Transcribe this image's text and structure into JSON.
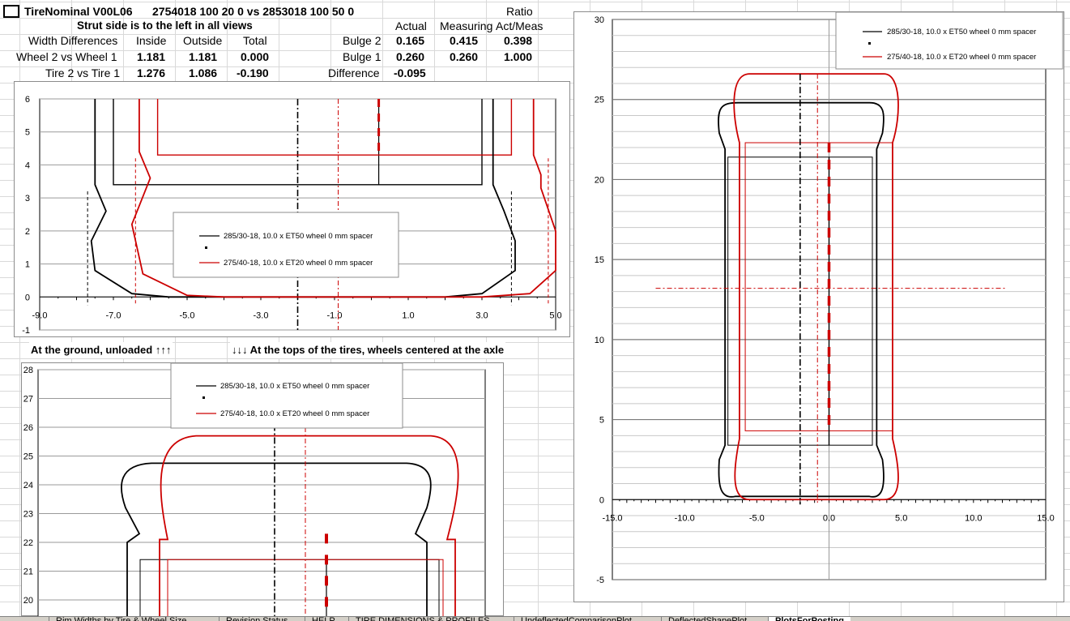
{
  "header": {
    "title": "TireNominal V00L06",
    "compare": "2754018 100 20 0 vs  2853018 100 50 0",
    "ratio_label": "Ratio",
    "strut_note": "Strut side is to the left in all views"
  },
  "width_table": {
    "title": "Width Differences",
    "col_inside": "Inside",
    "col_outside": "Outside",
    "col_total": "Total",
    "rows": [
      {
        "label": "Wheel 2 vs Wheel 1",
        "inside": "1.181",
        "outside": "1.181",
        "total": "0.000"
      },
      {
        "label": "Tire 2 vs Tire 1",
        "inside": "1.276",
        "outside": "1.086",
        "total": "-0.190"
      }
    ]
  },
  "bulge_table": {
    "col_actual": "Actual",
    "col_measuring": "Measuring",
    "col_ratio": "Act/Meas",
    "rows": [
      {
        "label": "Bulge 2",
        "actual": "0.165",
        "measuring": "0.415",
        "ratio": "0.398"
      },
      {
        "label": "Bulge 1",
        "actual": "0.260",
        "measuring": "0.260",
        "ratio": "1.000"
      },
      {
        "label": "Difference",
        "actual": "-0.095",
        "measuring": "",
        "ratio": ""
      }
    ]
  },
  "captions": {
    "ground": "At the ground, unloaded ↑↑↑",
    "tops": "↓↓↓ At the tops of the tires, wheels centered at the axle"
  },
  "legend": {
    "tire1": "285/30-18, 10.0 x ET50 wheel 0 mm spacer",
    "tire2": "275/40-18, 10.0 x ET20 wheel 0 mm spacer"
  },
  "colors": {
    "tire1": "#000000",
    "tire2": "#cc0000"
  },
  "chart_data": [
    {
      "type": "line",
      "name": "ground-view",
      "xlim": [
        -9.0,
        5.0
      ],
      "ylim": [
        -1,
        6
      ],
      "x_ticks": [
        "-9.0",
        "-7.0",
        "-5.0",
        "-3.0",
        "-1.0",
        "1.0",
        "3.0",
        "5.0"
      ],
      "y_ticks": [
        "-1",
        "0",
        "1",
        "2",
        "3",
        "4",
        "5",
        "6"
      ],
      "series": [
        {
          "name": "285/30-18, 10.0 x ET50 wheel 0 mm spacer",
          "color": "#000000",
          "points": [
            [
              -7.5,
              6
            ],
            [
              -7.5,
              3.4
            ],
            [
              -7.2,
              2.6
            ],
            [
              -7.6,
              1.7
            ],
            [
              -7.5,
              0.8
            ],
            [
              -6.5,
              0.1
            ],
            [
              -5.5,
              0
            ],
            [
              2.0,
              0
            ],
            [
              3.0,
              0.1
            ],
            [
              3.9,
              0.8
            ],
            [
              3.9,
              1.7
            ],
            [
              3.6,
              2.6
            ],
            [
              3.3,
              3.4
            ],
            [
              3.3,
              6
            ]
          ]
        },
        {
          "name": "275/40-18, 10.0 x ET20 wheel 0 mm spacer",
          "color": "#cc0000",
          "points": [
            [
              -6.3,
              6
            ],
            [
              -6.3,
              4.4
            ],
            [
              -6.0,
              3.6
            ],
            [
              -6.5,
              2.2
            ],
            [
              -6.2,
              0.7
            ],
            [
              -5.0,
              0.05
            ],
            [
              -4.0,
              0
            ],
            [
              3.0,
              0
            ],
            [
              4.3,
              0.1
            ],
            [
              5.0,
              0.8
            ],
            [
              5.0,
              2.0
            ],
            [
              4.6,
              3.3
            ],
            [
              4.6,
              3.7
            ],
            [
              4.4,
              4.3
            ],
            [
              4.4,
              6
            ]
          ]
        }
      ]
    },
    {
      "type": "line",
      "name": "tops-view",
      "ylim": [
        20,
        28
      ],
      "y_ticks": [
        "20",
        "21",
        "22",
        "23",
        "24",
        "25",
        "26",
        "27",
        "28"
      ],
      "series": [
        {
          "name": "285/30-18, 10.0 x ET50 wheel 0 mm spacer",
          "color": "#000000"
        },
        {
          "name": "275/40-18, 10.0 x ET20 wheel 0 mm spacer",
          "color": "#cc0000"
        }
      ]
    },
    {
      "type": "line",
      "name": "full-view",
      "xlim": [
        -15.0,
        15.0
      ],
      "ylim": [
        -5,
        30
      ],
      "x_ticks": [
        "-15.0",
        "-10.0",
        "-5.0",
        "0.0",
        "5.0",
        "10.0",
        "15.0"
      ],
      "y_ticks": [
        "-5",
        "0",
        "5",
        "10",
        "15",
        "20",
        "25",
        "30"
      ],
      "series": [
        {
          "name": "285/30-18, 10.0 x ET50 wheel 0 mm spacer",
          "color": "#000000"
        },
        {
          "name": "275/40-18, 10.0 x ET20 wheel 0 mm spacer",
          "color": "#cc0000"
        }
      ]
    }
  ],
  "sheet_tabs": [
    "Rim Widths by Tire & Wheel Size",
    "Revision Status",
    "HELP",
    "TIRE DIMENSIONS & PROFILES",
    "UndeflectedComparisonPlot",
    "DeflectedShapePlot",
    "PlotsForPosting"
  ]
}
